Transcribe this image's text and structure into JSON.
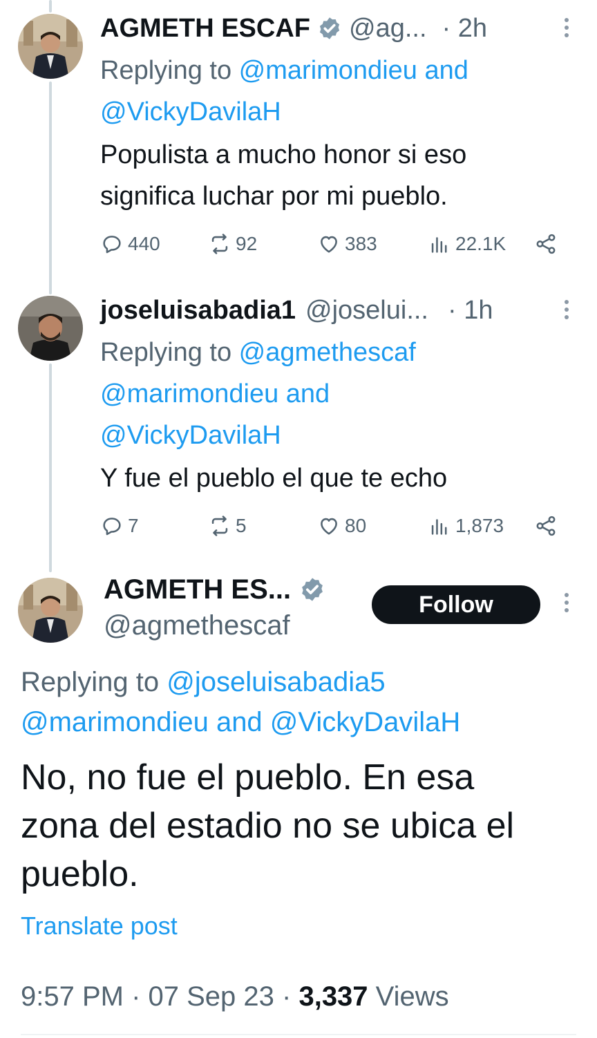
{
  "colors": {
    "link": "#1d9bf0",
    "muted": "#536471",
    "text": "#0f1419",
    "verified": "#829aab"
  },
  "tweets": [
    {
      "name": "AGMETH ESCAF",
      "handle": "@ag...",
      "time": "· 2h",
      "replying_prefix": "Replying to ",
      "mention_1": "@marimondieu",
      "and_1": " and",
      "mention_2": "@VickyDavilaH",
      "body_line_1": "Populista a mucho honor si eso",
      "body_line_2": "significa luchar por mi pueblo.",
      "replies": "440",
      "reposts": "92",
      "likes": "383",
      "views": "22.1K"
    },
    {
      "name": "joseluisabadia1",
      "handle": "@joselui...",
      "time": "· 1h",
      "replying_prefix": "Replying to ",
      "mention_1": "@agmethescaf",
      "mention_2": "@marimondieu",
      "and_1": " and",
      "mention_3": "@VickyDavilaH",
      "body_line_1": "Y fue el pueblo el que te echo",
      "replies": "7",
      "reposts": "5",
      "likes": "80",
      "views": "1,873"
    }
  ],
  "main_tweet": {
    "name": "AGMETH ES...",
    "handle": "@agmethescaf",
    "follow_label": "Follow",
    "replying_prefix": "Replying to ",
    "mention_1": "@joseluisabadia5",
    "mention_2": "@marimondieu",
    "and_1": " and ",
    "mention_3": "@VickyDavilaH",
    "body_line_1": "No, no fue el pueblo. En esa",
    "body_line_2": "zona del estadio no se ubica el",
    "body_line_3": "pueblo.",
    "translate_label": "Translate post",
    "time": "9:57 PM",
    "sep_1": " · ",
    "date": "07 Sep 23",
    "sep_2": " · ",
    "views_count": "3,337",
    "views_label": " Views"
  }
}
